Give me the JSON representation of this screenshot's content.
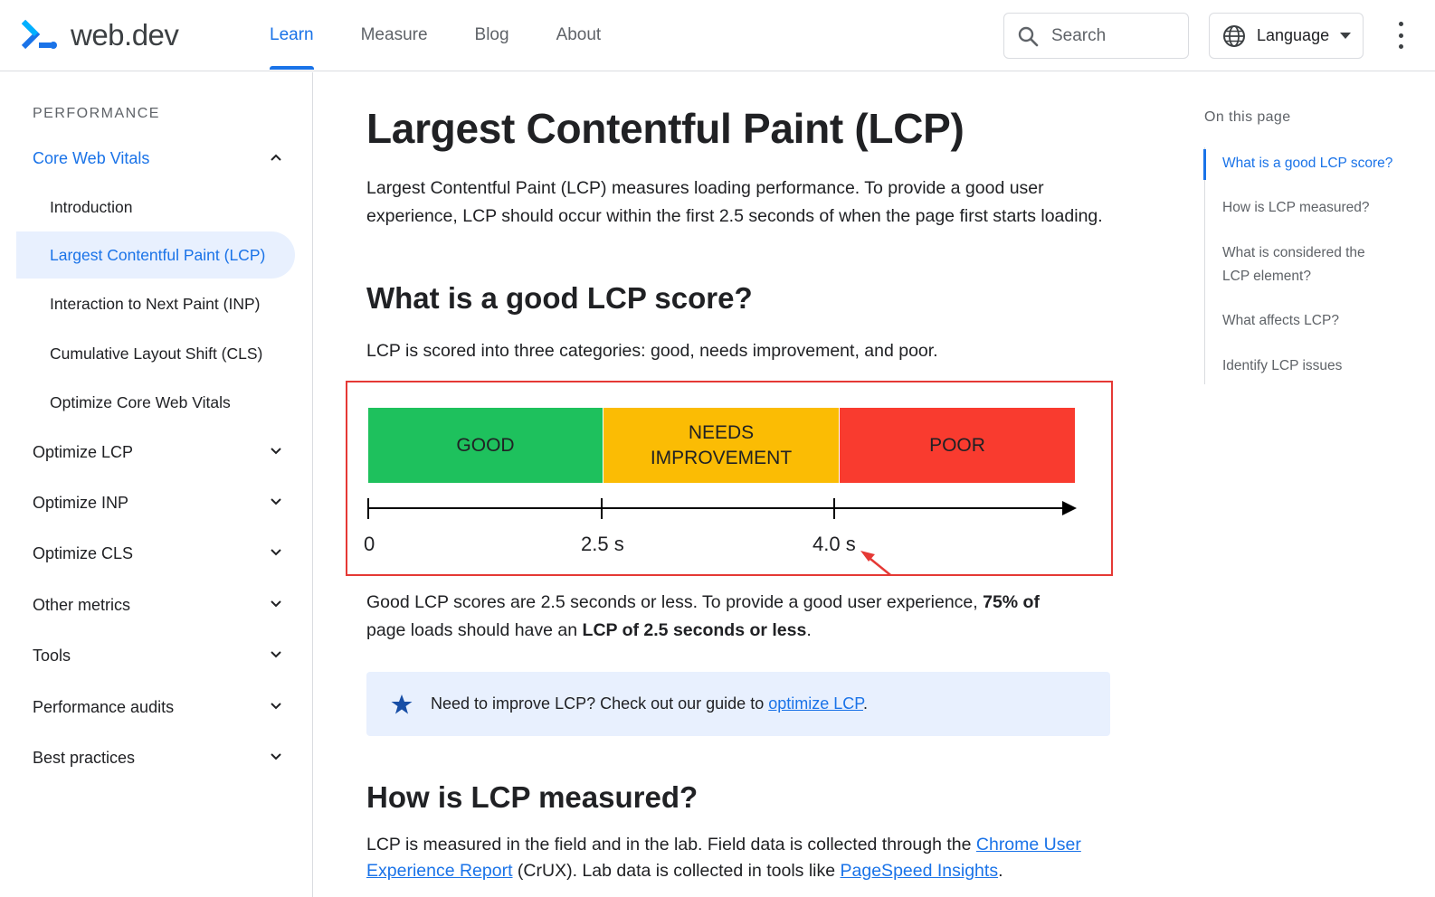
{
  "header": {
    "logo_text": "web.dev",
    "nav": [
      {
        "label": "Learn",
        "active": true
      },
      {
        "label": "Measure",
        "active": false
      },
      {
        "label": "Blog",
        "active": false
      },
      {
        "label": "About",
        "active": false
      }
    ],
    "search_placeholder": "Search",
    "language_label": "Language",
    "icons": {
      "search": "search-icon",
      "language": "globe-icon",
      "menu": "more-vert-icon"
    }
  },
  "sidebar": {
    "section": "PERFORMANCE",
    "items": [
      {
        "label": "Core Web Vitals",
        "level": "top",
        "expanded": true
      },
      {
        "label": "Introduction",
        "level": "sub"
      },
      {
        "label": "Largest Contentful Paint (LCP)",
        "level": "sub",
        "selected": true
      },
      {
        "label": "Interaction to Next Paint (INP)",
        "level": "sub"
      },
      {
        "label": "Cumulative Layout Shift (CLS)",
        "level": "sub"
      },
      {
        "label": "Optimize Core Web Vitals",
        "level": "sub"
      },
      {
        "label": "Optimize LCP",
        "level": "top"
      },
      {
        "label": "Optimize INP",
        "level": "top"
      },
      {
        "label": "Optimize CLS",
        "level": "top"
      },
      {
        "label": "Other metrics",
        "level": "top"
      },
      {
        "label": "Tools",
        "level": "top"
      },
      {
        "label": "Performance audits",
        "level": "top"
      },
      {
        "label": "Best practices",
        "level": "top"
      }
    ]
  },
  "main": {
    "title": "Largest Contentful Paint (LCP)",
    "intro": "Largest Contentful Paint (LCP) measures loading performance. To provide a good user experience, LCP should occur within the first 2.5 seconds of when the page first starts loading.",
    "section1_heading": "What is a good LCP score?",
    "section1_text": "LCP is scored into three categories: good, needs improvement, and poor.",
    "diagram": {
      "bands": [
        {
          "label": "GOOD",
          "color": "#1ec15d"
        },
        {
          "label": "NEEDS IMPROVEMENT",
          "label_line1": "NEEDS",
          "label_line2": "IMPROVEMENT",
          "color": "#fbbc04"
        },
        {
          "label": "POOR",
          "color": "#f93b2f"
        }
      ],
      "thresholds": [
        "0",
        "2.5 s",
        "4.0 s"
      ],
      "highlight_color": "#e53935"
    },
    "good_text_1": "Good LCP scores are 2.5 seconds or less. To provide a good user experience, ",
    "good_text_bold1": "75% of",
    "good_text_2": "page loads should have an ",
    "good_text_bold2": "LCP of 2.5 seconds or less",
    "good_text_end": ".",
    "callout_prefix": "Need to improve LCP? Check out our guide to ",
    "callout_link": "optimize LCP",
    "callout_suffix": ".",
    "section2_heading": "How is LCP measured?",
    "section2_text_1": "LCP is measured in the field and in the lab. Field data is collected through the ",
    "section2_link1_a": "Chrome User",
    "section2_link1_b": "Experience Report",
    "section2_text_2": " (CrUX). Lab data is collected in tools like ",
    "section2_link2": "PageSpeed Insights",
    "section2_text_3": "."
  },
  "toc": {
    "title": "On this page",
    "items": [
      {
        "label": "What is a good LCP score?",
        "active": true
      },
      {
        "label": "How is LCP measured?"
      },
      {
        "label": "What is considered the LCP element?",
        "line1": "What is considered the",
        "line2": "LCP element?"
      },
      {
        "label": "What affects LCP?"
      },
      {
        "label": "Identify LCP issues"
      }
    ]
  },
  "colors": {
    "accent": "#1a73e8",
    "good": "#1ec15d",
    "needs_improvement": "#fbbc04",
    "poor": "#f93b2f"
  }
}
